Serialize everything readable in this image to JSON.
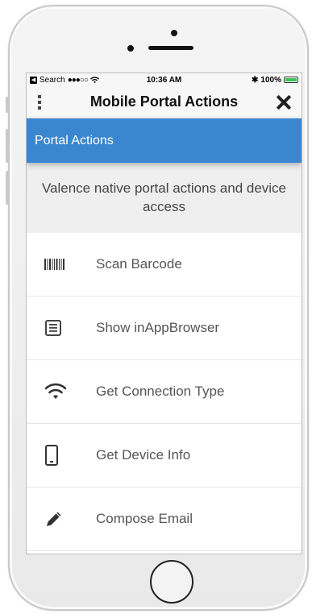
{
  "status_bar": {
    "back_label": "Search",
    "signal": "●●●○○",
    "time": "10:36 AM",
    "bluetooth": "✱",
    "battery": "100%"
  },
  "header": {
    "title": "Mobile Portal Actions"
  },
  "section": {
    "title": "Portal Actions",
    "description": "Valence native portal actions and device access"
  },
  "actions": [
    {
      "label": "Scan Barcode",
      "icon": "barcode-icon"
    },
    {
      "label": "Show inAppBrowser",
      "icon": "document-icon"
    },
    {
      "label": "Get Connection Type",
      "icon": "wifi-icon"
    },
    {
      "label": "Get Device Info",
      "icon": "phone-icon"
    },
    {
      "label": "Compose Email",
      "icon": "pencil-icon"
    }
  ],
  "colors": {
    "accent": "#3a87d0",
    "description_bg": "#efefef"
  }
}
